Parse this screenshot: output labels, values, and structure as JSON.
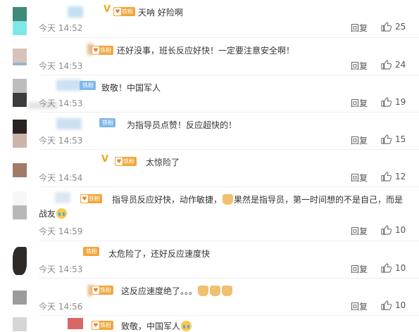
{
  "colors": {
    "fan_gold": "#f2a63b",
    "fan_blue": "#7eb8ec",
    "vip_badge": "#f0a81b",
    "meta_text": "#8c8c8c"
  },
  "labels": {
    "reply": "回复",
    "fan_badge": "铁粉"
  },
  "icons": {
    "like": "thumbs-up-icon",
    "vip": "v-badge-icon"
  },
  "comments": [
    {
      "text": "天呐 好险啊",
      "time": "今天 14:52",
      "likes": "25"
    },
    {
      "text": "还好没事，班长反应好快！一定要注意安全啊！",
      "time": "今天 14:53",
      "likes": "24"
    },
    {
      "text": "致敬！中国军人",
      "time": "今天 14:53",
      "likes": "19"
    },
    {
      "text": "为指导员点赞！反应超快的！",
      "time": "今天 14:53",
      "likes": "15"
    },
    {
      "text": "太惊险了",
      "time": "今天 14:54",
      "likes": "12"
    },
    {
      "text_a": "指导员反应好快，动作敏捷，",
      "text_b": "果然是指导员，第一时间想的不是自己，而是",
      "text_c": "战友",
      "time": "今天 14:59",
      "likes": "10"
    },
    {
      "text": "太危险了，还好反应速度快",
      "time": "今天 14:53",
      "likes": "10"
    },
    {
      "text": "这反应速度绝了。。。",
      "time": "今天 14:56",
      "likes": "10"
    },
    {
      "text": "致敬，中国军人"
    }
  ]
}
